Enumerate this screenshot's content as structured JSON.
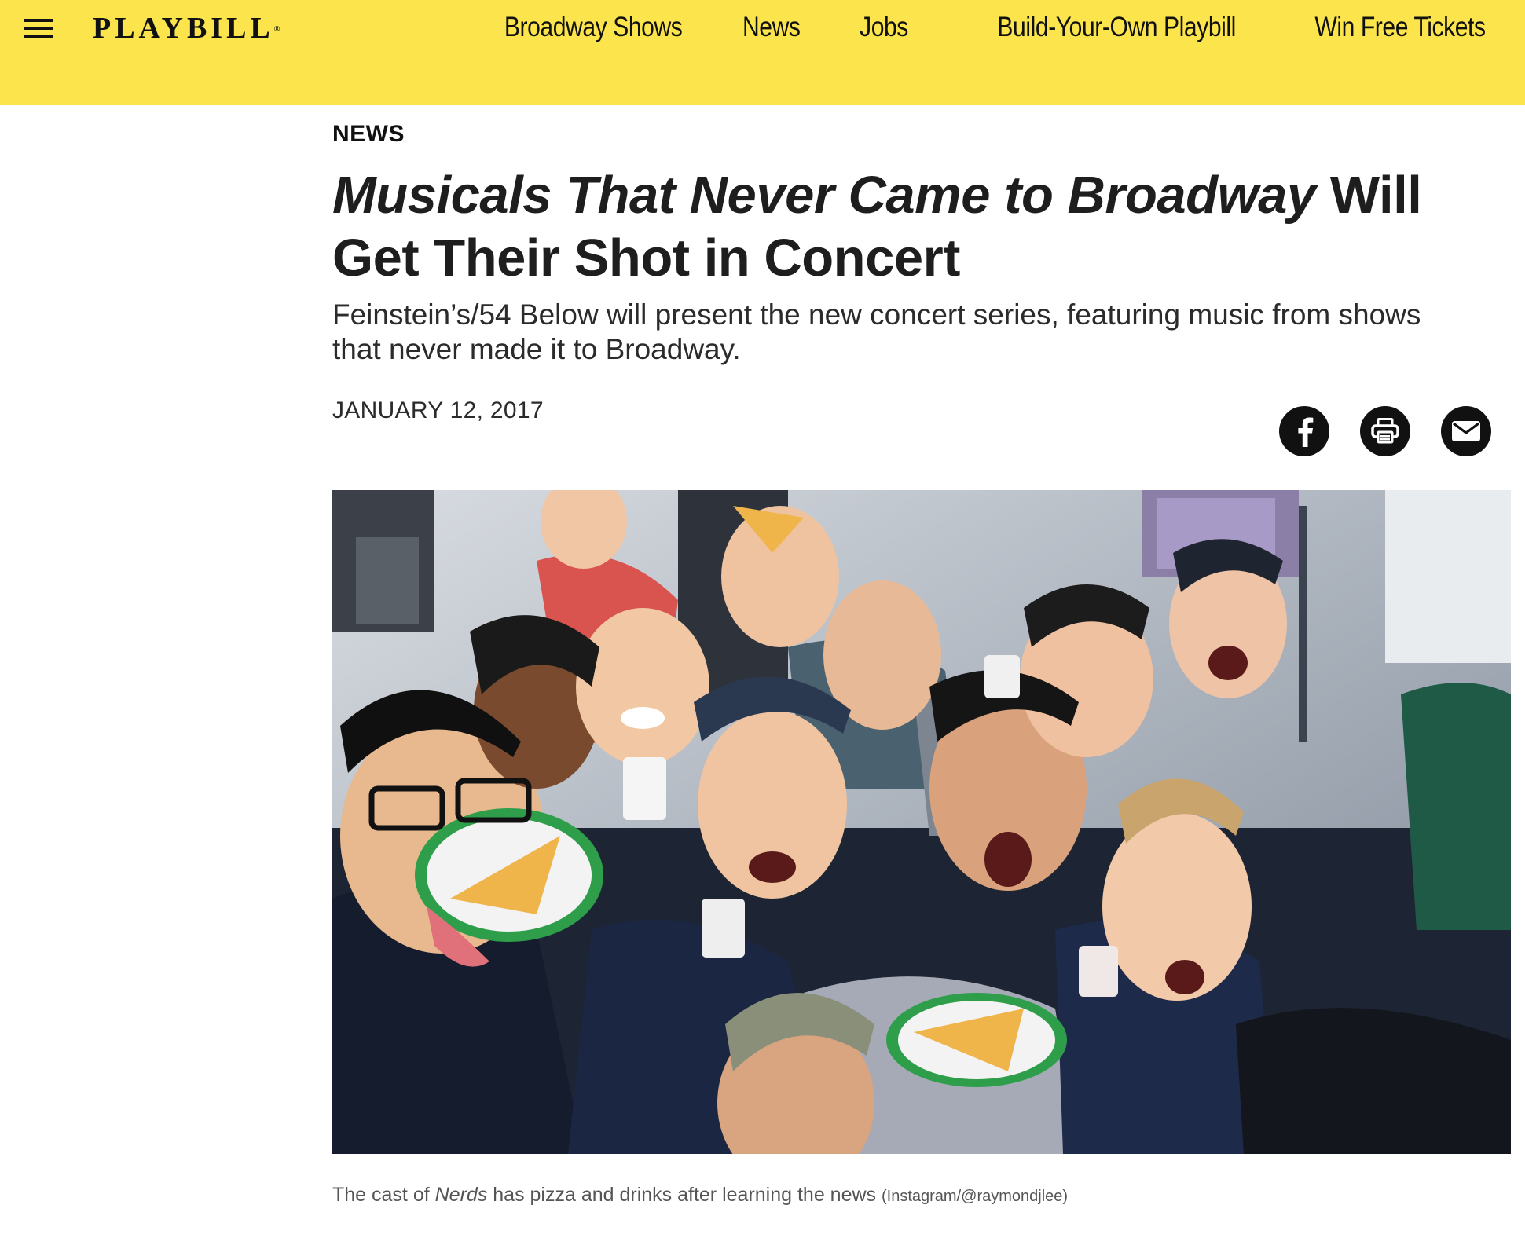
{
  "header": {
    "logo": "PLAYBILL",
    "logo_mark": "®",
    "menu_icon": "hamburger-menu-icon",
    "nav": [
      {
        "label": "Broadway Shows"
      },
      {
        "label": "News"
      },
      {
        "label": "Jobs"
      },
      {
        "label": "Build-Your-Own Playbill"
      },
      {
        "label": "Win Free Tickets"
      }
    ],
    "background_color": "#fbe44c"
  },
  "article": {
    "section": "NEWS",
    "headline_italic": "Musicals That Never Came to Broadway",
    "headline_rest": " Will Get Their Shot in Concert",
    "subhead": "Feinstein’s/54 Below will present the new concert series, featuring music from shows that never made it to Broadway.",
    "date": "JANUARY 12, 2017",
    "share": [
      {
        "icon": "facebook-icon"
      },
      {
        "icon": "print-icon"
      },
      {
        "icon": "email-icon"
      }
    ],
    "photo": {
      "subject": "group-selfie-photo"
    },
    "caption": {
      "before": "The cast of ",
      "title": "Nerds",
      "after": " has pizza and drinks after learning the news",
      "credit": "(Instagram/@raymondjlee)"
    }
  }
}
